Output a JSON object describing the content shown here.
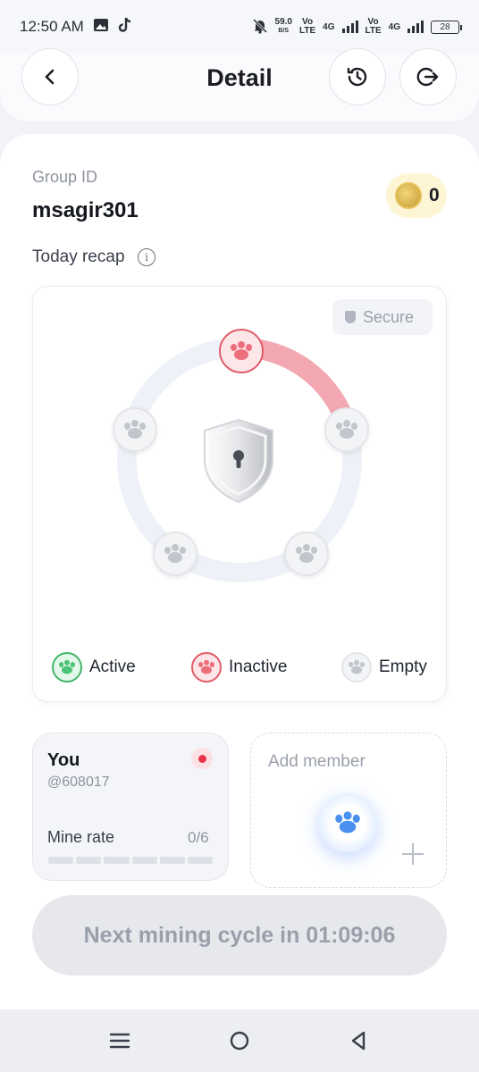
{
  "status_bar": {
    "time": "12:50 AM",
    "speed_value": "59.0",
    "speed_unit": "B/S",
    "sim1_label_top": "Vo",
    "sim1_label_bottom": "LTE",
    "sim2_label_top": "Vo",
    "sim2_label_bottom": "LTE",
    "net1": "4G",
    "net2": "4G",
    "battery": "28",
    "icons": [
      "gallery-icon",
      "tiktok-icon",
      "mute-icon",
      "signal-icon",
      "battery-icon"
    ]
  },
  "header": {
    "title": "Detail",
    "back_icon": "chevron-left-icon",
    "history_icon": "history-icon",
    "leave_icon": "exit-icon"
  },
  "group": {
    "label": "Group ID",
    "id": "msagir301",
    "coin_balance": "0"
  },
  "recap": {
    "label": "Today recap",
    "secure_label": "Secure",
    "nodes": [
      {
        "status": "inactive"
      },
      {
        "status": "empty"
      },
      {
        "status": "empty"
      },
      {
        "status": "empty"
      },
      {
        "status": "empty"
      }
    ],
    "legend": {
      "active": "Active",
      "inactive": "Inactive",
      "empty": "Empty"
    },
    "colors": {
      "active": "#43b56a",
      "inactive": "#e25b6a",
      "empty": "#c9ccd3",
      "ring": "#eef2f8",
      "arc": "#f39aa3"
    }
  },
  "members": {
    "you": {
      "name": "You",
      "handle": "@608017",
      "mine_rate_label": "Mine rate",
      "mine_rate_value": "0/6",
      "mine_rate_filled": 0,
      "mine_rate_total": 6
    },
    "add_member_label": "Add member"
  },
  "cycle": {
    "text": "Next mining cycle in 01:09:06"
  },
  "nav": {
    "menu_icon": "menu-icon",
    "home_icon": "home-circle-icon",
    "back_icon": "back-triangle-icon"
  }
}
